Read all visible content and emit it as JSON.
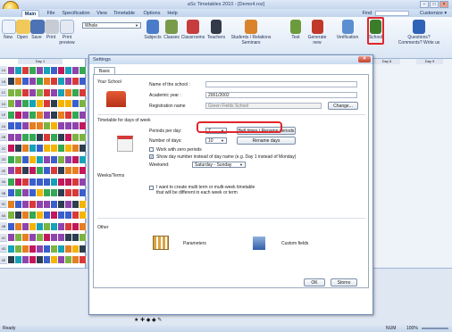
{
  "window": {
    "title": "aSc Timetables 2010 - [Demo4.roz]",
    "find_label": "Find",
    "customize_label": "Customize ▾"
  },
  "menu_tabs": [
    "Main",
    "File",
    "Specification",
    "View",
    "Timetable",
    "Options",
    "Help"
  ],
  "ribbon": {
    "new": "New",
    "open": "Open",
    "save": "Save",
    "print": "Print",
    "print_preview": "Print\npreview",
    "view_select": "Whole",
    "subjects": "Subjects",
    "classes": "Classes",
    "classrooms": "Classrooms",
    "teachers": "Teachers",
    "students": "Students / Relations\nSeminars",
    "test": "Test",
    "generate": "Generate\nnew",
    "verification": "Verification",
    "school": "School",
    "questions": "Questions?\nComments? Write us"
  },
  "grid": {
    "rows": [
      "1A",
      "1B",
      "1C",
      "1D",
      "1E",
      "2A",
      "2B",
      "2C",
      "2D",
      "2E",
      "3A",
      "3B",
      "3C",
      "4A",
      "4B",
      "4C",
      "4D",
      "4E"
    ],
    "day_labels": [
      "Day 1",
      "Day 8",
      "Day 9"
    ]
  },
  "dialog": {
    "title": "Settings",
    "tab": "Basic data",
    "your_school": "Your School",
    "school_name_label": "Name of the school :",
    "school_name_value": "",
    "academic_year_label": "Academic year :",
    "academic_year_value": "2001/2002",
    "registration_label": "Registration name",
    "registration_value": "Green Fields School",
    "change_button": "Change...",
    "days_section": "Timetable for days of week",
    "periods_label": "Periods per day:",
    "periods_value": "7",
    "bell_button": "Bell times / Rename periods",
    "days_label": "Number of days:",
    "days_value": "10",
    "rename_days_button": "Rename days",
    "zero_periods": "Work with zero periods",
    "show_day_number": "Show day number instead of day name (e.g. Day 1 instead of Monday)",
    "weekend_label": "Weekend:",
    "weekend_value": "Saturday - Sunday",
    "weeks_section": "Weeks/Terms",
    "weeks_checkbox": "I want to create multi term or multi-week timetable that will be different in each week or term",
    "other_section": "Other",
    "parameters": "Parameters",
    "custom_fields": "Custom fields",
    "ok_button": "OK",
    "cancel_button": "Storno"
  },
  "status": {
    "left": "Ready",
    "num": "NUM",
    "zoom": "100%"
  }
}
